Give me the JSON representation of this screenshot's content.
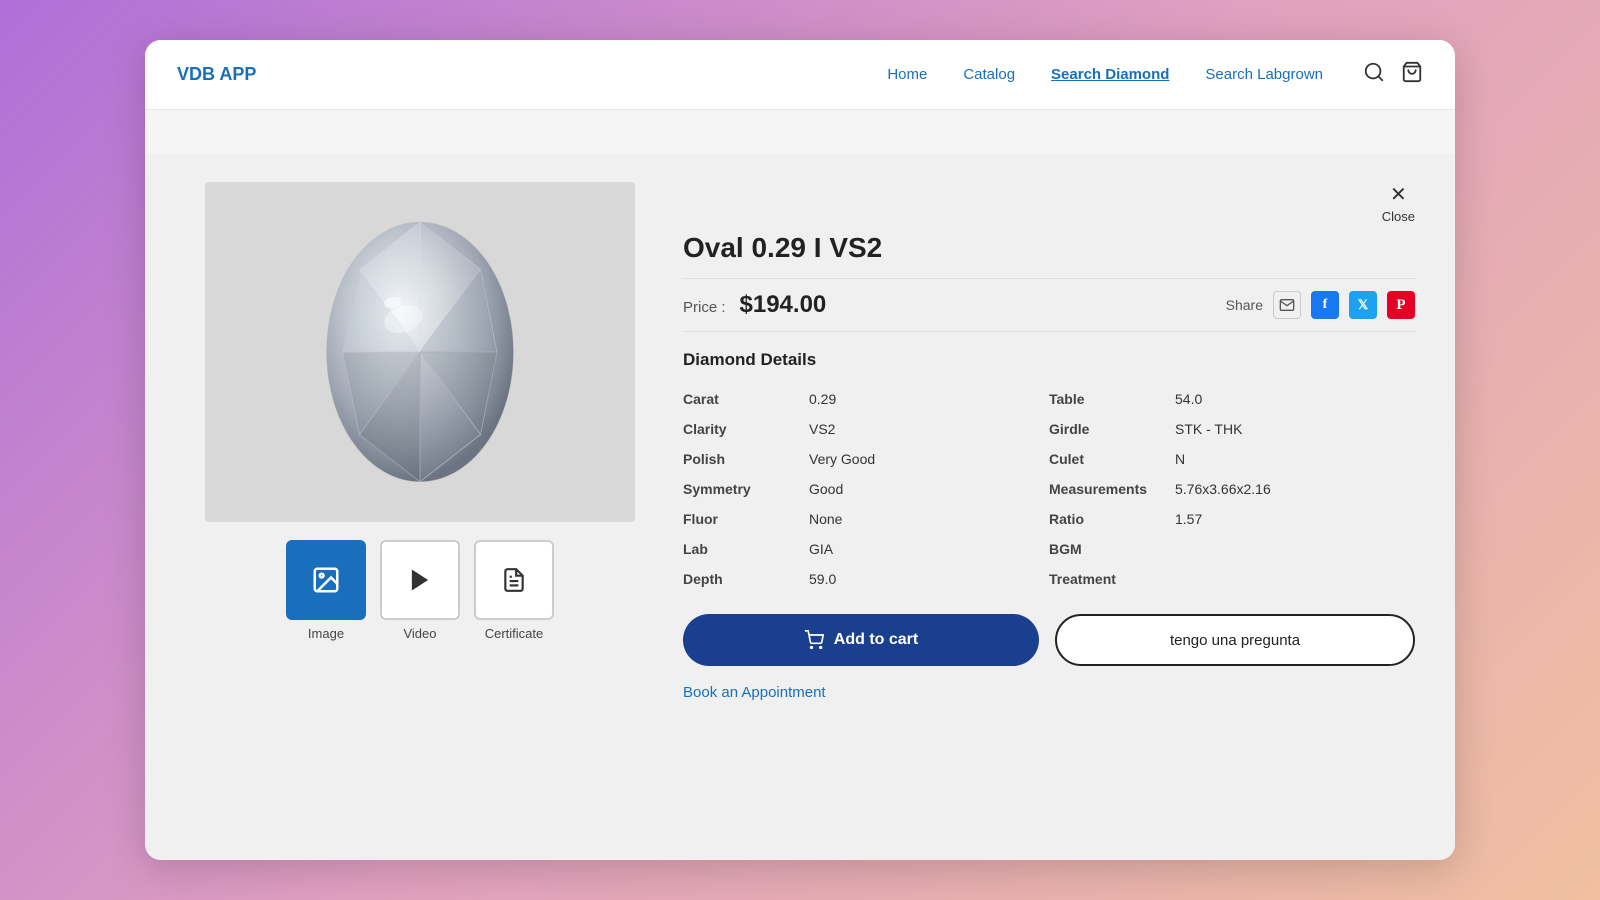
{
  "app": {
    "logo": "VDB APP"
  },
  "nav": {
    "links": [
      {
        "label": "Home",
        "active": false
      },
      {
        "label": "Catalog",
        "active": false
      },
      {
        "label": "Search Diamond",
        "active": true
      },
      {
        "label": "Search Labgrown",
        "active": false
      }
    ]
  },
  "close": {
    "icon": "✕",
    "label": "Close"
  },
  "diamond": {
    "title": "Oval 0.29 I VS2",
    "price_label": "Price :",
    "price": "$194.00",
    "share_label": "Share",
    "details_title": "Diamond Details",
    "details_left": [
      {
        "key": "Carat",
        "value": "0.29"
      },
      {
        "key": "Clarity",
        "value": "VS2"
      },
      {
        "key": "Polish",
        "value": "Very Good"
      },
      {
        "key": "Symmetry",
        "value": "Good"
      },
      {
        "key": "Fluor",
        "value": "None"
      },
      {
        "key": "Lab",
        "value": "GIA"
      },
      {
        "key": "Depth",
        "value": "59.0"
      }
    ],
    "details_right": [
      {
        "key": "Table",
        "value": "54.0"
      },
      {
        "key": "Girdle",
        "value": "STK - THK"
      },
      {
        "key": "Culet",
        "value": "N"
      },
      {
        "key": "Measurements",
        "value": "5.76x3.66x2.16"
      },
      {
        "key": "Ratio",
        "value": "1.57"
      },
      {
        "key": "BGM",
        "value": ""
      },
      {
        "key": "Treatment",
        "value": ""
      }
    ]
  },
  "thumbnails": [
    {
      "label": "Image",
      "active": true,
      "icon": "🖼"
    },
    {
      "label": "Video",
      "active": false,
      "icon": "▶"
    },
    {
      "label": "Certificate",
      "active": false,
      "icon": "📄"
    }
  ],
  "buttons": {
    "add_to_cart": "Add to cart",
    "question": "tengo una pregunta",
    "appointment": "Book an Appointment"
  }
}
